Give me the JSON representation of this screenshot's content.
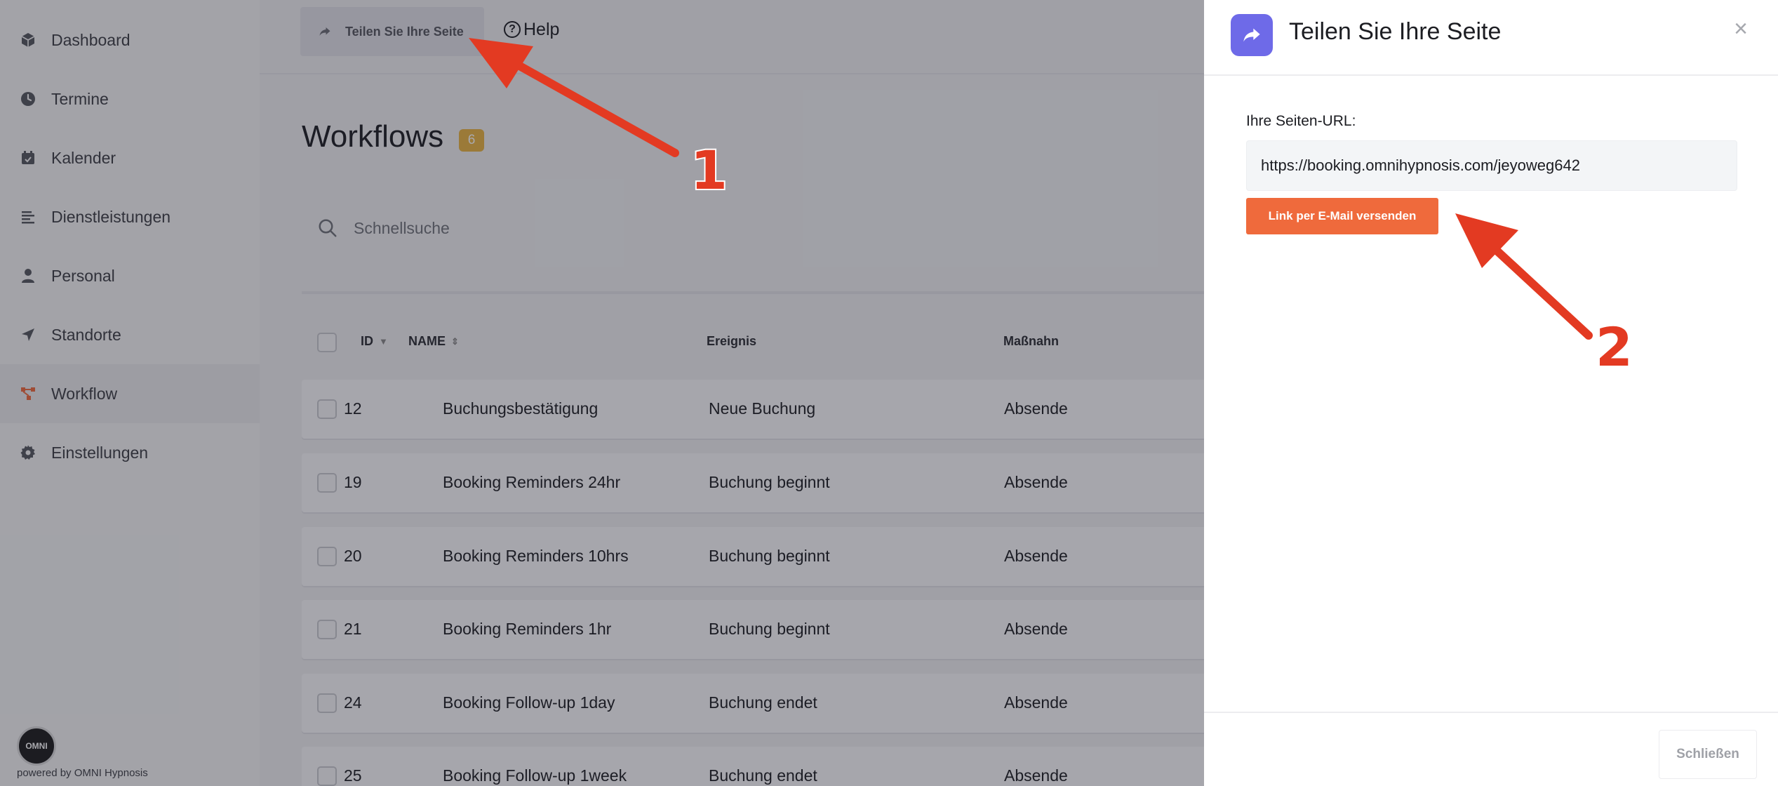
{
  "sidebar": {
    "items": [
      {
        "label": "Dashboard",
        "icon": "cube-icon"
      },
      {
        "label": "Termine",
        "icon": "clock-icon"
      },
      {
        "label": "Kalender",
        "icon": "calendar-check-icon"
      },
      {
        "label": "Dienstleistungen",
        "icon": "list-lines-icon"
      },
      {
        "label": "Personal",
        "icon": "person-icon"
      },
      {
        "label": "Standorte",
        "icon": "location-arrow-icon"
      },
      {
        "label": "Workflow",
        "icon": "workflow-icon"
      },
      {
        "label": "Einstellungen",
        "icon": "gear-icon"
      }
    ],
    "active_index": 6,
    "footer_text": "powered by OMNI Hypnosis",
    "logo_text": "OMNI"
  },
  "topbar": {
    "share_label": "Teilen Sie Ihre Seite",
    "help_label": "Help"
  },
  "main": {
    "title": "Workflows",
    "count": "6",
    "search_placeholder": "Schnellsuche",
    "columns": {
      "id": "ID",
      "name": "NAME",
      "event": "Ereignis",
      "action": "Maßnahn"
    },
    "rows": [
      {
        "id": "12",
        "name": "Buchungsbestätigung",
        "event": "Neue Buchung",
        "action": "Absende"
      },
      {
        "id": "19",
        "name": "Booking Reminders 24hr",
        "event": "Buchung beginnt",
        "action": "Absende"
      },
      {
        "id": "20",
        "name": "Booking Reminders 10hrs",
        "event": "Buchung beginnt",
        "action": "Absende"
      },
      {
        "id": "21",
        "name": "Booking Reminders 1hr",
        "event": "Buchung beginnt",
        "action": "Absende"
      },
      {
        "id": "24",
        "name": "Booking Follow-up 1day",
        "event": "Buchung endet",
        "action": "Absende"
      },
      {
        "id": "25",
        "name": "Booking Follow-up 1week",
        "event": "Buchung endet",
        "action": "Absende"
      }
    ]
  },
  "modal": {
    "title": "Teilen Sie Ihre Seite",
    "url_label": "Ihre Seiten-URL:",
    "url_value": "https://booking.omnihypnosis.com/jeyoweg642",
    "email_button": "Link per E-Mail versenden",
    "close_button": "Schließen",
    "close_icon": "×"
  },
  "annotations": {
    "first": "1",
    "second": "2"
  },
  "colors": {
    "accent": "#ef6a3c",
    "modal_icon": "#6e6ae8",
    "badge": "#e8b441",
    "arrow": "#e33a22",
    "workflow_icon": "#ef6a3c"
  }
}
